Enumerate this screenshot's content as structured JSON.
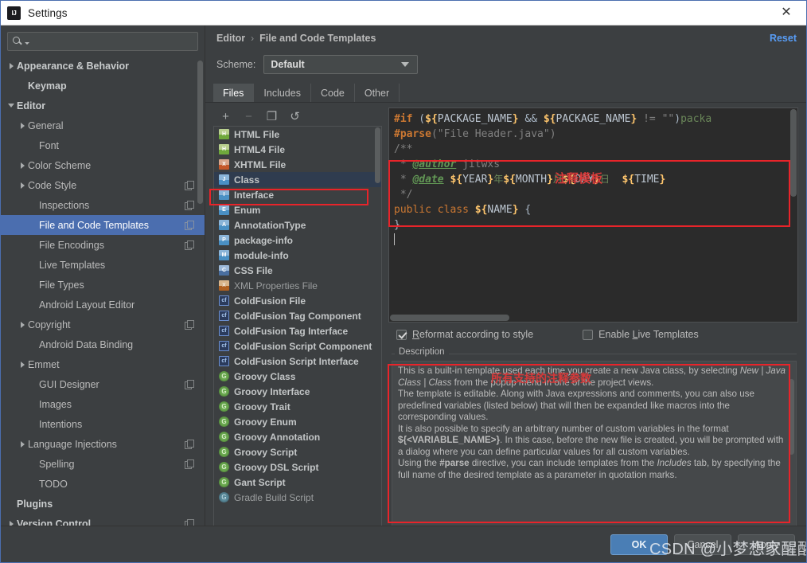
{
  "window": {
    "title": "Settings",
    "logo_icon": "intellij-idea-logo",
    "close_icon": "close-icon"
  },
  "sidebar": {
    "search": {
      "placeholder": "",
      "value": "",
      "icon": "search-icon"
    },
    "items": [
      {
        "label": "Appearance & Behavior",
        "twisty": "collapsed",
        "bold": true,
        "indent": 1,
        "badge": false
      },
      {
        "label": "Keymap",
        "twisty": "none",
        "bold": true,
        "indent": 2,
        "badge": false
      },
      {
        "label": "Editor",
        "twisty": "expanded",
        "bold": true,
        "indent": 1,
        "badge": false
      },
      {
        "label": "General",
        "twisty": "collapsed",
        "bold": false,
        "indent": 2,
        "badge": false
      },
      {
        "label": "Font",
        "twisty": "none",
        "bold": false,
        "indent": 3,
        "badge": false
      },
      {
        "label": "Color Scheme",
        "twisty": "collapsed",
        "bold": false,
        "indent": 2,
        "badge": false
      },
      {
        "label": "Code Style",
        "twisty": "collapsed",
        "bold": false,
        "indent": 2,
        "badge": true
      },
      {
        "label": "Inspections",
        "twisty": "none",
        "bold": false,
        "indent": 3,
        "badge": true
      },
      {
        "label": "File and Code Templates",
        "twisty": "none",
        "bold": false,
        "indent": 3,
        "badge": true,
        "selected": true
      },
      {
        "label": "File Encodings",
        "twisty": "none",
        "bold": false,
        "indent": 3,
        "badge": true
      },
      {
        "label": "Live Templates",
        "twisty": "none",
        "bold": false,
        "indent": 3,
        "badge": false
      },
      {
        "label": "File Types",
        "twisty": "none",
        "bold": false,
        "indent": 3,
        "badge": false
      },
      {
        "label": "Android Layout Editor",
        "twisty": "none",
        "bold": false,
        "indent": 3,
        "badge": false
      },
      {
        "label": "Copyright",
        "twisty": "collapsed",
        "bold": false,
        "indent": 2,
        "badge": true
      },
      {
        "label": "Android Data Binding",
        "twisty": "none",
        "bold": false,
        "indent": 3,
        "badge": false
      },
      {
        "label": "Emmet",
        "twisty": "collapsed",
        "bold": false,
        "indent": 2,
        "badge": false
      },
      {
        "label": "GUI Designer",
        "twisty": "none",
        "bold": false,
        "indent": 3,
        "badge": true
      },
      {
        "label": "Images",
        "twisty": "none",
        "bold": false,
        "indent": 3,
        "badge": false
      },
      {
        "label": "Intentions",
        "twisty": "none",
        "bold": false,
        "indent": 3,
        "badge": false
      },
      {
        "label": "Language Injections",
        "twisty": "collapsed",
        "bold": false,
        "indent": 2,
        "badge": true
      },
      {
        "label": "Spelling",
        "twisty": "none",
        "bold": false,
        "indent": 3,
        "badge": true
      },
      {
        "label": "TODO",
        "twisty": "none",
        "bold": false,
        "indent": 3,
        "badge": false
      },
      {
        "label": "Plugins",
        "twisty": "none",
        "bold": true,
        "indent": 1,
        "badge": false
      },
      {
        "label": "Version Control",
        "twisty": "collapsed",
        "bold": true,
        "indent": 1,
        "badge": true
      }
    ],
    "help_button": "?"
  },
  "header": {
    "breadcrumb": [
      "Editor",
      "File and Code Templates"
    ],
    "breadcrumb_separator": "›",
    "reset_label": "Reset",
    "scheme_label": "Scheme:",
    "scheme_value": "Default"
  },
  "tabs": [
    {
      "label": "Files",
      "active": true
    },
    {
      "label": "Includes",
      "active": false
    },
    {
      "label": "Code",
      "active": false
    },
    {
      "label": "Other",
      "active": false
    }
  ],
  "list_toolbar": [
    {
      "name": "add-button",
      "glyph": "+"
    },
    {
      "name": "remove-button",
      "glyph": "−"
    },
    {
      "name": "copy-button",
      "glyph": "❐"
    },
    {
      "name": "reset-button",
      "glyph": "↺"
    }
  ],
  "template_list": [
    {
      "label": "HTML File",
      "icon": "html-file-icon",
      "badge": "H",
      "kind": "html"
    },
    {
      "label": "HTML4 File",
      "icon": "html4-file-icon",
      "badge": "H",
      "kind": "html"
    },
    {
      "label": "XHTML File",
      "icon": "xhtml-file-icon",
      "badge": "X",
      "kind": "xhtml"
    },
    {
      "label": "Class",
      "icon": "java-class-icon",
      "badge": "J",
      "kind": "java",
      "selected": true
    },
    {
      "label": "Interface",
      "icon": "java-interface-icon",
      "badge": "I",
      "kind": "java"
    },
    {
      "label": "Enum",
      "icon": "java-enum-icon",
      "badge": "E",
      "kind": "java"
    },
    {
      "label": "AnnotationType",
      "icon": "java-annotation-icon",
      "badge": "A",
      "kind": "java"
    },
    {
      "label": "package-info",
      "icon": "java-package-icon",
      "badge": "P",
      "kind": "java"
    },
    {
      "label": "module-info",
      "icon": "java-module-icon",
      "badge": "M",
      "kind": "java"
    },
    {
      "label": "CSS File",
      "icon": "css-file-icon",
      "badge": "C",
      "kind": "css"
    },
    {
      "label": "XML Properties File",
      "icon": "xml-file-icon",
      "badge": "X",
      "kind": "xml",
      "dim": true
    },
    {
      "label": "ColdFusion File",
      "icon": "coldfusion-icon",
      "badge": "cf",
      "kind": "cf"
    },
    {
      "label": "ColdFusion Tag Component",
      "icon": "coldfusion-icon",
      "badge": "cf",
      "kind": "cf"
    },
    {
      "label": "ColdFusion Tag Interface",
      "icon": "coldfusion-icon",
      "badge": "cf",
      "kind": "cf"
    },
    {
      "label": "ColdFusion Script Component",
      "icon": "coldfusion-icon",
      "badge": "cf",
      "kind": "cf"
    },
    {
      "label": "ColdFusion Script Interface",
      "icon": "coldfusion-icon",
      "badge": "cf",
      "kind": "cf"
    },
    {
      "label": "Groovy Class",
      "icon": "groovy-icon",
      "badge": "G",
      "kind": "groovy"
    },
    {
      "label": "Groovy Interface",
      "icon": "groovy-icon",
      "badge": "G",
      "kind": "groovy"
    },
    {
      "label": "Groovy Trait",
      "icon": "groovy-icon",
      "badge": "G",
      "kind": "groovy"
    },
    {
      "label": "Groovy Enum",
      "icon": "groovy-icon",
      "badge": "G",
      "kind": "groovy"
    },
    {
      "label": "Groovy Annotation",
      "icon": "groovy-icon",
      "badge": "G",
      "kind": "groovy"
    },
    {
      "label": "Groovy Script",
      "icon": "groovy-icon",
      "badge": "G",
      "kind": "groovy"
    },
    {
      "label": "Groovy DSL Script",
      "icon": "groovy-icon",
      "badge": "G",
      "kind": "groovy"
    },
    {
      "label": "Gant Script",
      "icon": "gant-icon",
      "badge": "G",
      "kind": "groovy"
    },
    {
      "label": "Gradle Build Script",
      "icon": "gradle-icon",
      "badge": "G",
      "kind": "gradle",
      "dim": true
    }
  ],
  "editor": {
    "lines": [
      "#if (${PACKAGE_NAME} && ${PACKAGE_NAME} != \"\")packa",
      "#parse(\"File Header.java\")",
      "/**",
      " * @author jitwxs",
      " * @date ${YEAR}年${MONTH}月${DAY}日 ${TIME}",
      " */",
      "public class ${NAME} {",
      "}",
      ""
    ]
  },
  "checkboxes": [
    {
      "label": "Reformat according to style",
      "checked": true,
      "mnemonic": "R"
    },
    {
      "label": "Enable Live Templates",
      "checked": false,
      "mnemonic": "L"
    }
  ],
  "description": {
    "legend": "Description",
    "paragraphs": [
      "This is a built-in template used each time you create a new Java class, by selecting New | Java Class | Class from the popup menu in one of the project views.",
      "The template is editable. Along with Java expressions and comments, you can also use predefined variables (listed below) that will then be expanded like macros into the corresponding values.",
      "It is also possible to specify an arbitrary number of custom variables in the format ${<VARIABLE_NAME>}. In this case, before the new file is created, you will be prompted with a dialog where you can define particular values for all custom variables.",
      "Using the #parse directive, you can include templates from the Includes tab, by specifying the full name of the desired template as a parameter in quotation marks."
    ]
  },
  "buttons": {
    "ok": "OK",
    "cancel": "Cancel",
    "apply": "Apply"
  },
  "annotations": [
    {
      "name": "comment-template-annotation",
      "text": "注释模板"
    },
    {
      "name": "supported-parameters-annotation",
      "text": "所有支持的注释参数"
    }
  ],
  "watermark": "CSDN @小梦想家醒醒啦",
  "colors": {
    "accent_selection": "#4b6eaf",
    "link": "#589df6",
    "annotation_red": "#e8242a",
    "panel_bg": "#3c3f41",
    "editor_bg": "#2b2b2b",
    "primary_button": "#4a7eb5"
  }
}
